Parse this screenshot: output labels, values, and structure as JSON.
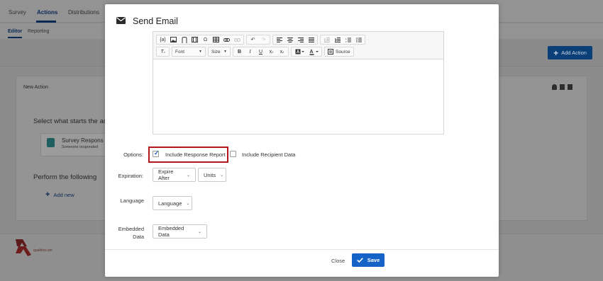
{
  "background": {
    "tabs": [
      {
        "label": "Survey",
        "active": false
      },
      {
        "label": "Actions",
        "active": true
      },
      {
        "label": "Distributions",
        "active": false
      }
    ],
    "subtabs": [
      {
        "label": "Editor",
        "active": true
      },
      {
        "label": "Reporting",
        "active": false
      }
    ],
    "add_action_label": "Add Action",
    "panel_title": "New Action",
    "select_trigger_text": "Select what starts the ac",
    "trigger_card_title": "Survey Respons",
    "trigger_card_subtitle": "Someone responded",
    "perform_text": "Perform the following",
    "add_new_label": "Add new",
    "logo_text": "qualtrics.xm"
  },
  "modal": {
    "title": "Send Email",
    "icon": "envelope-icon",
    "toolbar": {
      "row1": [
        "insert-field",
        "image",
        "attachment",
        "media",
        "omega-special-char",
        "table",
        "link",
        "unlink",
        "undo",
        "redo",
        "align-left",
        "align-center",
        "align-right",
        "justify",
        "outdent",
        "indent",
        "numbered-list",
        "bulleted-list"
      ],
      "font_label": "Font",
      "size_label": "Size",
      "source_label": "Source"
    },
    "options_label": "Options:",
    "include_response_report_label": "Include Response Report",
    "include_response_report_checked": true,
    "include_recipient_data_label": "Include Recipient Data",
    "include_recipient_data_checked": false,
    "expiration_label": "Expiration:",
    "expire_after_value": "Expire After",
    "units_value": "Units",
    "language_label": "Language",
    "language_value": "Language",
    "embedded_label_line1": "Embedded",
    "embedded_label_line2": "Data",
    "embedded_value": "Embedded Data",
    "close_label": "Close",
    "save_label": "Save"
  },
  "colors": {
    "accent": "#1663c7",
    "highlight": "#b5161b"
  }
}
